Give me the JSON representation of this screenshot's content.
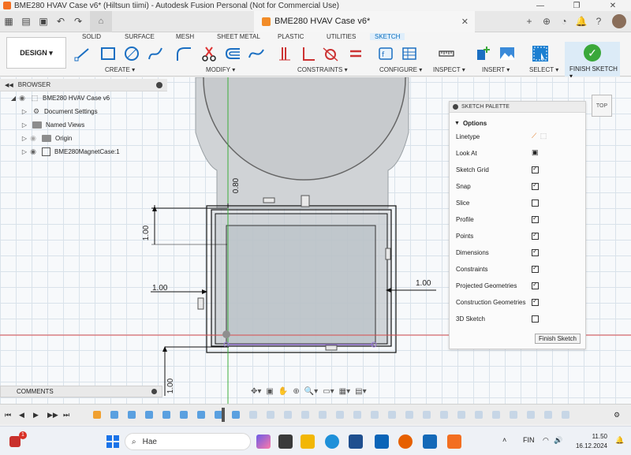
{
  "window": {
    "title": "BME280 HVAV Case v6* (Hiltsun tiimi) - Autodesk Fusion Personal (Not for Commercial Use)"
  },
  "document_tab": {
    "label": "BME280 HVAV Case v6*"
  },
  "toolbar": {
    "workspace": "DESIGN",
    "tabs": [
      "SOLID",
      "SURFACE",
      "MESH",
      "SHEET METAL",
      "PLASTIC",
      "UTILITIES",
      "SKETCH"
    ],
    "active_tab": "SKETCH",
    "groups": [
      "CREATE",
      "MODIFY",
      "CONSTRAINTS",
      "CONFIGURE",
      "INSPECT",
      "INSERT",
      "SELECT",
      "FINISH SKETCH"
    ]
  },
  "browser": {
    "title": "BROWSER",
    "items": [
      {
        "label": "BME280 HVAV Case v6"
      },
      {
        "label": "Document Settings"
      },
      {
        "label": "Named Views"
      },
      {
        "label": "Origin"
      },
      {
        "label": "BME280MagnetCase:1"
      }
    ]
  },
  "palette": {
    "title": "SKETCH PALETTE",
    "section": "Options",
    "rows": [
      {
        "label": "Linetype",
        "type": "icons"
      },
      {
        "label": "Look At",
        "type": "icon"
      },
      {
        "label": "Sketch Grid",
        "type": "check",
        "checked": true
      },
      {
        "label": "Snap",
        "type": "check",
        "checked": true
      },
      {
        "label": "Slice",
        "type": "check",
        "checked": false
      },
      {
        "label": "Profile",
        "type": "check",
        "checked": true
      },
      {
        "label": "Points",
        "type": "check",
        "checked": true
      },
      {
        "label": "Dimensions",
        "type": "check",
        "checked": true
      },
      {
        "label": "Constraints",
        "type": "check",
        "checked": true
      },
      {
        "label": "Projected Geometries",
        "type": "check",
        "checked": true
      },
      {
        "label": "Construction Geometries",
        "type": "check",
        "checked": true
      },
      {
        "label": "3D Sketch",
        "type": "check",
        "checked": false
      }
    ],
    "finish_button": "Finish Sketch"
  },
  "viewcube": {
    "label": "TOP"
  },
  "dimensions": {
    "top_offset": "0.80",
    "left_vertical": "1.00",
    "left_horizontal": "1.00",
    "right_horizontal": "1.00",
    "bottom_vertical": "1.00"
  },
  "comments": {
    "label": "COMMENTS"
  },
  "taskbar": {
    "search_placeholder": "Hae",
    "language": "FIN",
    "time": "11.50",
    "date": "16.12.2024",
    "notification_count": "1"
  }
}
